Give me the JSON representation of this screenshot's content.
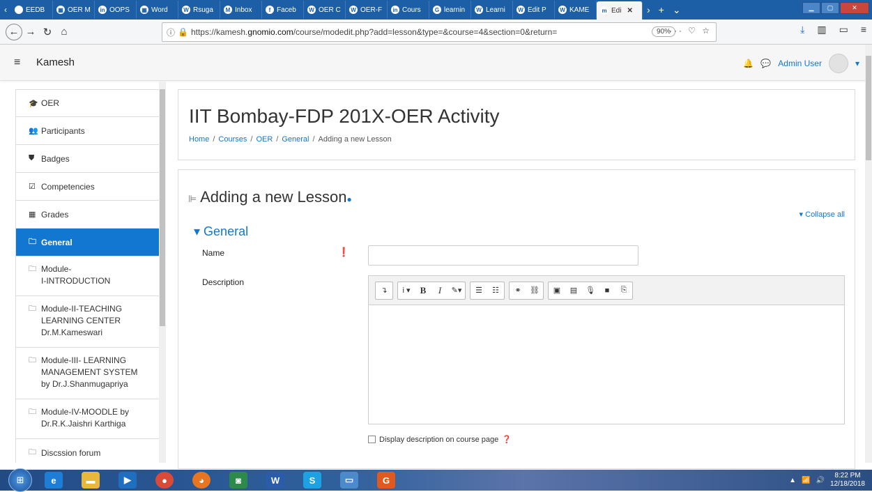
{
  "browser": {
    "tabs": [
      {
        "label": "EEDB",
        "icon": "bookmark-icon",
        "glyph": ""
      },
      {
        "label": "OER M",
        "icon": "grid-icon",
        "glyph": "▦"
      },
      {
        "label": "OOPS",
        "icon": "in-icon",
        "glyph": "in"
      },
      {
        "label": "Word",
        "icon": "grid-icon",
        "glyph": "▦"
      },
      {
        "label": "Rsuga",
        "icon": "wordpress-icon",
        "glyph": "W"
      },
      {
        "label": "Inbox",
        "icon": "mail-icon",
        "glyph": "M"
      },
      {
        "label": "Faceb",
        "icon": "facebook-icon",
        "glyph": "f"
      },
      {
        "label": "OER C",
        "icon": "wordpress-icon",
        "glyph": "W"
      },
      {
        "label": "OER-F",
        "icon": "wordpress-icon",
        "glyph": "W"
      },
      {
        "label": "Cours",
        "icon": "in-icon",
        "glyph": "in"
      },
      {
        "label": "learnin",
        "icon": "google-icon",
        "glyph": "G"
      },
      {
        "label": "Learni",
        "icon": "word-icon",
        "glyph": "W"
      },
      {
        "label": "Edit P",
        "icon": "wordpress-icon",
        "glyph": "W"
      },
      {
        "label": "KAME",
        "icon": "wordpress-icon",
        "glyph": "W"
      },
      {
        "label": "Edi",
        "icon": "moodle-icon",
        "glyph": "m",
        "active": true
      }
    ],
    "close_glyph": "✕",
    "new_tab_glyph": "+",
    "url_prefix": "https://kamesh.",
    "url_domain": "gnomio.com",
    "url_rest": "/course/modedit.php?add=lesson&type=&course=4&section=0&return=",
    "zoom": "90%"
  },
  "header": {
    "site_name": "Kamesh",
    "user_name": "Admin User"
  },
  "sidebar": {
    "items": [
      {
        "label": "OER",
        "icon": "graduation-cap-icon",
        "glyph": "🎓"
      },
      {
        "label": "Participants",
        "icon": "users-icon",
        "glyph": "👥"
      },
      {
        "label": "Badges",
        "icon": "shield-icon",
        "glyph": "⛊"
      },
      {
        "label": "Competencies",
        "icon": "checkbox-icon",
        "glyph": "☑"
      },
      {
        "label": "Grades",
        "icon": "table-icon",
        "glyph": "▦"
      },
      {
        "label": "General",
        "icon": "folder-icon",
        "glyph": "🗀",
        "active": true
      },
      {
        "label": "Module-\nI-INTRODUCTION",
        "icon": "folder-icon",
        "glyph": "🗀"
      },
      {
        "label": "Module-II-TEACHING\nLEARNING CENTER\nDr.M.Kameswari",
        "icon": "folder-icon",
        "glyph": "🗀"
      },
      {
        "label": "Module-III- LEARNING\nMANAGEMENT SYSTEM\nby Dr.J.Shanmugapriya",
        "icon": "folder-icon",
        "glyph": "🗀"
      },
      {
        "label": "Module-IV-MOODLE by\nDr.R.K.Jaishri Karthiga",
        "icon": "folder-icon",
        "glyph": "🗀"
      },
      {
        "label": "Discssion forum",
        "icon": "folder-icon",
        "glyph": "🗀"
      }
    ]
  },
  "course": {
    "title": "IIT Bombay-FDP 201X-OER Activity",
    "breadcrumb": [
      "Home",
      "Courses",
      "OER",
      "General",
      "Adding a new Lesson"
    ]
  },
  "form": {
    "heading": "Adding a new Lesson",
    "collapse_all": "Collapse all",
    "section": "General",
    "name_label": "Name",
    "name_value": "",
    "description_label": "Description",
    "display_description": "Display description on course page"
  },
  "taskbar": {
    "time": "8:22 PM",
    "date": "12/18/2018"
  }
}
